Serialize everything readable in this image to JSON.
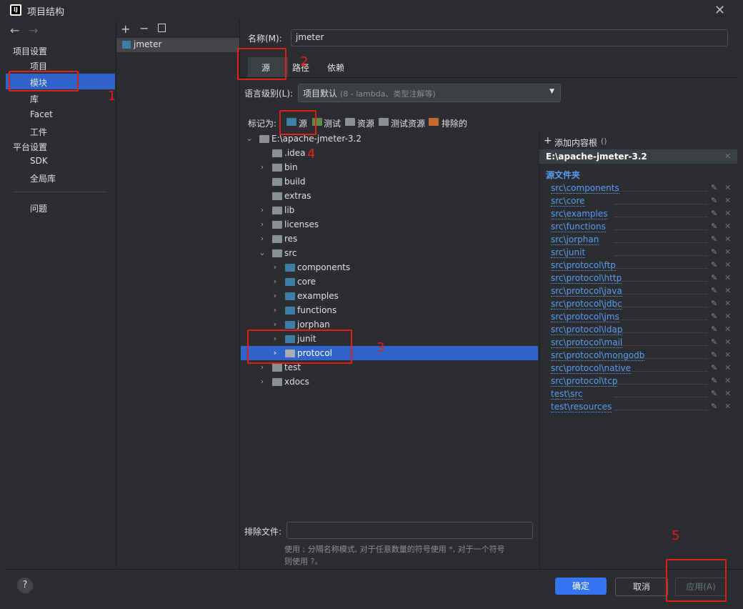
{
  "window": {
    "title": "项目结构"
  },
  "sidebar": {
    "section_project": "项目设置",
    "items_project": [
      "项目",
      "模块",
      "库",
      "Facet",
      "工件"
    ],
    "section_platform": "平台设置",
    "items_platform": [
      "SDK",
      "全局库"
    ],
    "problems": "问题"
  },
  "modules": {
    "list": [
      "jmeter"
    ]
  },
  "detail": {
    "name_label": "名称(M):",
    "name_value": "jmeter",
    "tabs": [
      "源",
      "路径",
      "依赖"
    ],
    "lang_label": "语言级别(L):",
    "lang_value": "项目默认",
    "lang_hint": "(8 - lambda、类型注解等)",
    "mark_label": "标记为:",
    "mark_options": [
      "源",
      "测试",
      "资源",
      "测试资源",
      "排除的"
    ],
    "exclude_label": "排除文件:",
    "exclude_hint_1": "使用 ; 分隔名称模式, 对于任意数量的符号使用 *, 对于一个符号",
    "exclude_hint_2": "则使用 ?。"
  },
  "tree": {
    "root": "E:\\apache-jmeter-3.2",
    "rows": [
      ".idea",
      "bin",
      "build",
      "extras",
      "lib",
      "licenses",
      "res",
      "src",
      "components",
      "core",
      "examples",
      "functions",
      "jorphan",
      "junit",
      "protocol",
      "test",
      "xdocs"
    ]
  },
  "content_root": {
    "add_label": "添加内容根",
    "root_path": "E:\\apache-jmeter-3.2",
    "source_header": "源文件夹",
    "sources": [
      "src\\components",
      "src\\core",
      "src\\examples",
      "src\\functions",
      "src\\jorphan",
      "src\\junit",
      "src\\protocol\\ftp",
      "src\\protocol\\http",
      "src\\protocol\\java",
      "src\\protocol\\jdbc",
      "src\\protocol\\jms",
      "src\\protocol\\ldap",
      "src\\protocol\\mail",
      "src\\protocol\\mongodb",
      "src\\protocol\\native",
      "src\\protocol\\tcp",
      "test\\src",
      "test\\resources"
    ]
  },
  "buttons": {
    "ok": "确定",
    "cancel": "取消",
    "apply": "应用(A)",
    "help": "?"
  },
  "annotations": [
    "1",
    "2",
    "3",
    "4",
    "5"
  ],
  "colors": {
    "accent": "#2f65ca",
    "annotation": "#e0201a",
    "link": "#589df6"
  }
}
